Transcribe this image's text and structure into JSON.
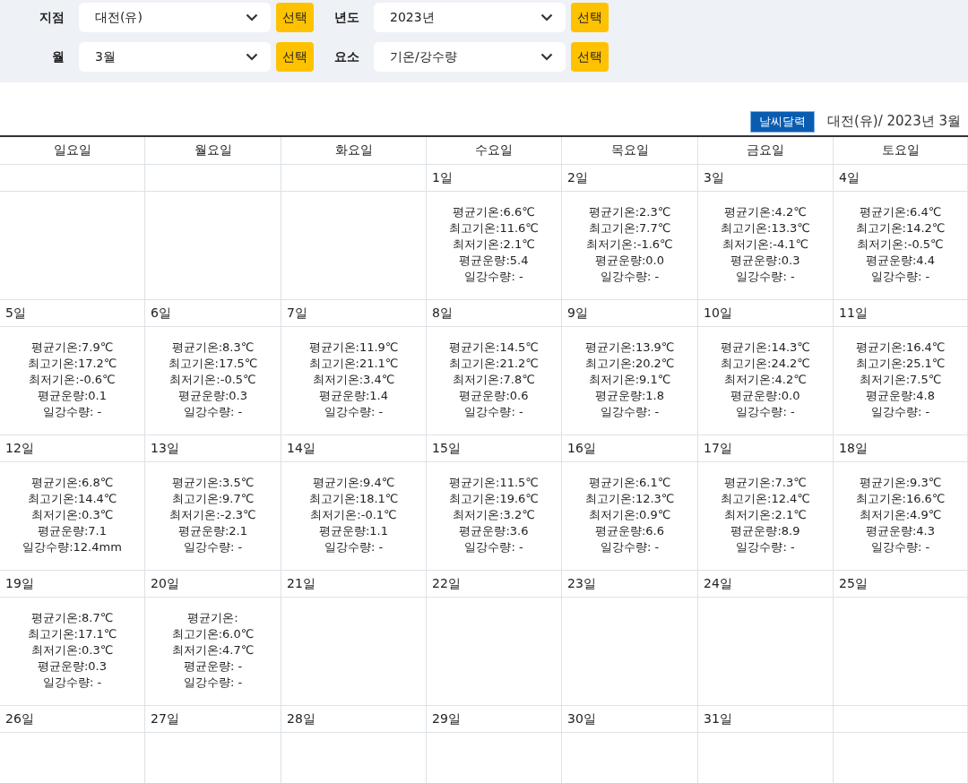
{
  "filters": [
    {
      "label": "지점",
      "value": "대전(유)",
      "button": "선택"
    },
    {
      "label": "년도",
      "value": "2023년",
      "button": "선택"
    },
    {
      "label": "월",
      "value": "3월",
      "button": "선택"
    },
    {
      "label": "요소",
      "value": "기온/강수량",
      "button": "선택"
    }
  ],
  "badge": "날씨달력",
  "title": "대전(유)/ 2023년 3월",
  "weekdays": [
    "일요일",
    "월요일",
    "화요일",
    "수요일",
    "목요일",
    "금요일",
    "토요일"
  ],
  "weeks": [
    {
      "kind": "lead",
      "days": [
        {
          "day": "1일",
          "lines": [
            "평균기온:6.6℃",
            "최고기온:11.6℃",
            "최저기온:2.1℃",
            "평균운량:5.4",
            "일강수량: -"
          ]
        },
        {
          "day": "2일",
          "lines": [
            "평균기온:2.3℃",
            "최고기온:7.7℃",
            "최저기온:-1.6℃",
            "평균운량:0.0",
            "일강수량: -"
          ]
        },
        {
          "day": "3일",
          "lines": [
            "평균기온:4.2℃",
            "최고기온:13.3℃",
            "최저기온:-4.1℃",
            "평균운량:0.3",
            "일강수량: -"
          ]
        },
        {
          "day": "4일",
          "lines": [
            "평균기온:6.4℃",
            "최고기온:14.2℃",
            "최저기온:-0.5℃",
            "평균운량:4.4",
            "일강수량: -"
          ]
        }
      ]
    },
    {
      "kind": "full",
      "days": [
        {
          "day": "5일",
          "lines": [
            "평균기온:7.9℃",
            "최고기온:17.2℃",
            "최저기온:-0.6℃",
            "평균운량:0.1",
            "일강수량: -"
          ]
        },
        {
          "day": "6일",
          "lines": [
            "평균기온:8.3℃",
            "최고기온:17.5℃",
            "최저기온:-0.5℃",
            "평균운량:0.3",
            "일강수량: -"
          ]
        },
        {
          "day": "7일",
          "lines": [
            "평균기온:11.9℃",
            "최고기온:21.1℃",
            "최저기온:3.4℃",
            "평균운량:1.4",
            "일강수량: -"
          ]
        },
        {
          "day": "8일",
          "lines": [
            "평균기온:14.5℃",
            "최고기온:21.2℃",
            "최저기온:7.8℃",
            "평균운량:0.6",
            "일강수량: -"
          ]
        },
        {
          "day": "9일",
          "lines": [
            "평균기온:13.9℃",
            "최고기온:20.2℃",
            "최저기온:9.1℃",
            "평균운량:1.8",
            "일강수량: -"
          ]
        },
        {
          "day": "10일",
          "lines": [
            "평균기온:14.3℃",
            "최고기온:24.2℃",
            "최저기온:4.2℃",
            "평균운량:0.0",
            "일강수량: -"
          ]
        },
        {
          "day": "11일",
          "lines": [
            "평균기온:16.4℃",
            "최고기온:25.1℃",
            "최저기온:7.5℃",
            "평균운량:4.8",
            "일강수량: -"
          ]
        }
      ]
    },
    {
      "kind": "full",
      "days": [
        {
          "day": "12일",
          "lines": [
            "평균기온:6.8℃",
            "최고기온:14.4℃",
            "최저기온:0.3℃",
            "평균운량:7.1",
            "일강수량:12.4mm"
          ]
        },
        {
          "day": "13일",
          "lines": [
            "평균기온:3.5℃",
            "최고기온:9.7℃",
            "최저기온:-2.3℃",
            "평균운량:2.1",
            "일강수량: -"
          ]
        },
        {
          "day": "14일",
          "lines": [
            "평균기온:9.4℃",
            "최고기온:18.1℃",
            "최저기온:-0.1℃",
            "평균운량:1.1",
            "일강수량: -"
          ]
        },
        {
          "day": "15일",
          "lines": [
            "평균기온:11.5℃",
            "최고기온:19.6℃",
            "최저기온:3.2℃",
            "평균운량:3.6",
            "일강수량: -"
          ]
        },
        {
          "day": "16일",
          "lines": [
            "평균기온:6.1℃",
            "최고기온:12.3℃",
            "최저기온:0.9℃",
            "평균운량:6.6",
            "일강수량: -"
          ]
        },
        {
          "day": "17일",
          "lines": [
            "평균기온:7.3℃",
            "최고기온:12.4℃",
            "최저기온:2.1℃",
            "평균운량:8.9",
            "일강수량: -"
          ]
        },
        {
          "day": "18일",
          "lines": [
            "평균기온:9.3℃",
            "최고기온:16.6℃",
            "최저기온:4.9℃",
            "평균운량:4.3",
            "일강수량: -"
          ]
        }
      ]
    },
    {
      "kind": "full",
      "days": [
        {
          "day": "19일",
          "lines": [
            "평균기온:8.7℃",
            "최고기온:17.1℃",
            "최저기온:0.3℃",
            "평균운량:0.3",
            "일강수량: -"
          ]
        },
        {
          "day": "20일",
          "lines": [
            "평균기온:",
            "최고기온:6.0℃",
            "최저기온:4.7℃",
            "평균운량: -",
            "일강수량: -"
          ]
        },
        {
          "day": "21일"
        },
        {
          "day": "22일"
        },
        {
          "day": "23일"
        },
        {
          "day": "24일"
        },
        {
          "day": "25일"
        }
      ]
    },
    {
      "kind": "trail",
      "days": [
        {
          "day": "26일"
        },
        {
          "day": "27일"
        },
        {
          "day": "28일"
        },
        {
          "day": "29일"
        },
        {
          "day": "30일"
        },
        {
          "day": "31일"
        }
      ]
    }
  ]
}
